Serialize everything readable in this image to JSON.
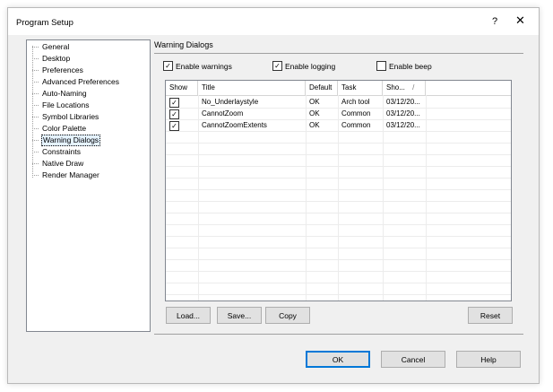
{
  "window": {
    "title": "Program Setup",
    "help_glyph": "?",
    "close_glyph": "✕"
  },
  "tree": {
    "items": [
      "General",
      "Desktop",
      "Preferences",
      "Advanced Preferences",
      "Auto-Naming",
      "File Locations",
      "Symbol Libraries",
      "Color Palette",
      "Warning Dialogs",
      "Constraints",
      "Native Draw",
      "Render Manager"
    ],
    "selected": "Warning Dialogs"
  },
  "section": {
    "title": "Warning Dialogs"
  },
  "options": {
    "enable_warnings": {
      "label": "Enable warnings",
      "checked": true
    },
    "enable_logging": {
      "label": "Enable logging",
      "checked": true
    },
    "enable_beep": {
      "label": "Enable beep",
      "checked": false
    }
  },
  "table": {
    "columns": [
      "Show",
      "Title",
      "Default",
      "Task",
      "Sho...",
      "/"
    ],
    "rows": [
      {
        "show": true,
        "title": "No_Underlaystyle",
        "default": "OK",
        "task": "Arch tool",
        "shown": "03/12/20..."
      },
      {
        "show": true,
        "title": "CannotZoom",
        "default": "OK",
        "task": "Common",
        "shown": "03/12/20..."
      },
      {
        "show": true,
        "title": "CannotZoomExtents",
        "default": "OK",
        "task": "Common",
        "shown": "03/12/20..."
      }
    ]
  },
  "buttons": {
    "load": "Load...",
    "save": "Save...",
    "copy": "Copy",
    "reset": "Reset",
    "ok": "OK",
    "cancel": "Cancel",
    "help": "Help"
  },
  "check_glyph": "✓"
}
